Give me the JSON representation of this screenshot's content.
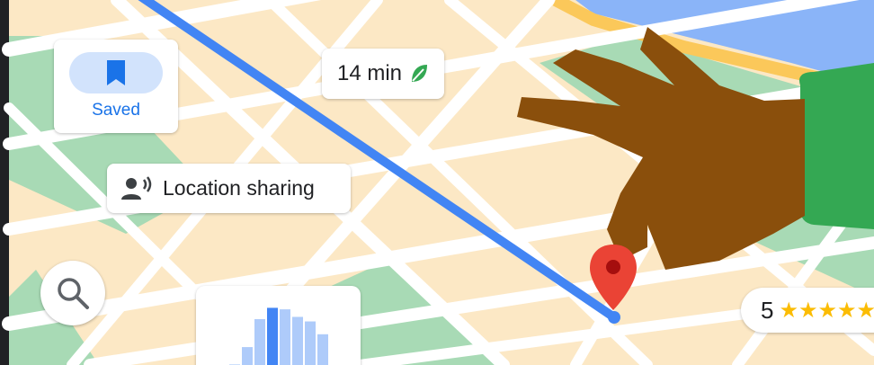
{
  "map": {
    "colors": {
      "land": "#fce8c5",
      "road": "#ffffff",
      "park": "#a8dab5",
      "water": "#8ab4f8",
      "coast": "#fbc85a",
      "route": "#4285f4",
      "pin": "#ea4335",
      "hand": "#8a4f0c",
      "sleeve": "#34a853"
    }
  },
  "saved": {
    "label": "Saved",
    "icon": "bookmark-icon"
  },
  "eta": {
    "text": "14 min",
    "icon": "leaf-icon"
  },
  "location_sharing": {
    "label": "Location sharing",
    "icon": "person-sharing-icon"
  },
  "search": {
    "icon": "search-icon"
  },
  "popular_times": {
    "values": [
      0.15,
      0.38,
      0.75,
      0.9,
      0.88,
      0.78,
      0.72,
      0.55
    ],
    "highlight_index": 3
  },
  "rating": {
    "value": "5",
    "stars": "★★★★★"
  }
}
